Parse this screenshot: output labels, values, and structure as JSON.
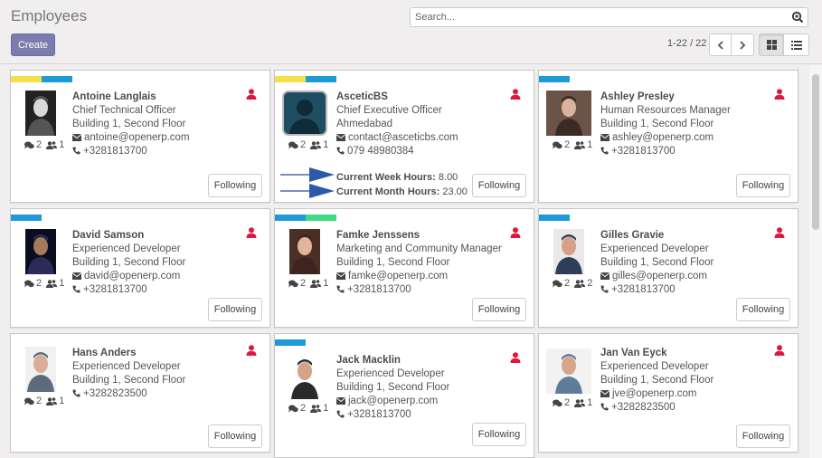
{
  "header": {
    "title": "Employees",
    "create_label": "Create",
    "search_placeholder": "Search...",
    "pager": "1-22 / 22"
  },
  "colors": {
    "accent": "#7c7bad",
    "tag_yellow": "#f4e04d",
    "tag_blue": "#1e9ad6",
    "tag_green": "#3ddc84",
    "user_icon": "#e0173f"
  },
  "cards": [
    {
      "name": "Antoine Langlais",
      "job": "Chief Technical Officer",
      "location": "Building 1, Second Floor",
      "email": "antoine@openerp.com",
      "phone": "+3281813700",
      "messages": "2",
      "followers": "1",
      "follow_label": "Following",
      "tags": [
        "yellow",
        "blue"
      ],
      "avatar": "bw-photo"
    },
    {
      "name": "AsceticBS",
      "job": "Chief Executive Officer",
      "location": "Ahmedabad",
      "email": "contact@asceticbs.com",
      "phone": "079 48980384",
      "messages": "2",
      "followers": "1",
      "follow_label": "Following",
      "tags": [
        "yellow",
        "blue"
      ],
      "avatar": "placeholder",
      "week_label": "Current Week Hours:",
      "week_value": "8.00",
      "month_label": "Current Month Hours:",
      "month_value": "23.00"
    },
    {
      "name": "Ashley Presley",
      "job": "Human Resources Manager",
      "location": "Building 1, Second Floor",
      "email": "ashley@openerp.com",
      "phone": "+3281813700",
      "messages": "2",
      "followers": "1",
      "follow_label": "Following",
      "tags": [
        "blue"
      ],
      "avatar": "woman-photo"
    },
    {
      "name": "David Samson",
      "job": "Experienced Developer",
      "location": "Building 1, Second Floor",
      "email": "david@openerp.com",
      "phone": "+3281813700",
      "messages": "2",
      "followers": "1",
      "follow_label": "Following",
      "tags": [
        "blue"
      ],
      "avatar": "dark-photo"
    },
    {
      "name": "Famke Jenssens",
      "job": "Marketing and Community Manager",
      "location": "Building 1, Second Floor",
      "email": "famke@openerp.com",
      "phone": "+3281813700",
      "messages": "2",
      "followers": "1",
      "follow_label": "Following",
      "tags": [
        "blue",
        "green"
      ],
      "avatar": "woman2-photo"
    },
    {
      "name": "Gilles Gravie",
      "job": "Experienced Developer",
      "location": "Building 1, Second Floor",
      "email": "gilles@openerp.com",
      "phone": "+3281813700",
      "messages": "2",
      "followers": "2",
      "follow_label": "Following",
      "tags": [
        "blue"
      ],
      "avatar": "man-photo"
    },
    {
      "name": "Hans Anders",
      "job": "Experienced Developer",
      "location": "Building 1, Second Floor",
      "email": "",
      "phone": "+3282823500",
      "messages": "2",
      "followers": "1",
      "follow_label": "Following",
      "tags": [],
      "avatar": "man2-photo"
    },
    {
      "name": "Jack Macklin",
      "job": "Experienced Developer",
      "location": "Building 1, Second Floor",
      "email": "jack@openerp.com",
      "phone": "+3281813700",
      "messages": "2",
      "followers": "1",
      "follow_label": "Following",
      "tags": [
        "blue"
      ],
      "avatar": "man3-photo"
    },
    {
      "name": "Jan Van Eyck",
      "job": "Experienced Developer",
      "location": "Building 1, Second Floor",
      "email": "jve@openerp.com",
      "phone": "+3282823500",
      "messages": "2",
      "followers": "1",
      "follow_label": "Following",
      "tags": [],
      "avatar": "man4-photo"
    }
  ]
}
